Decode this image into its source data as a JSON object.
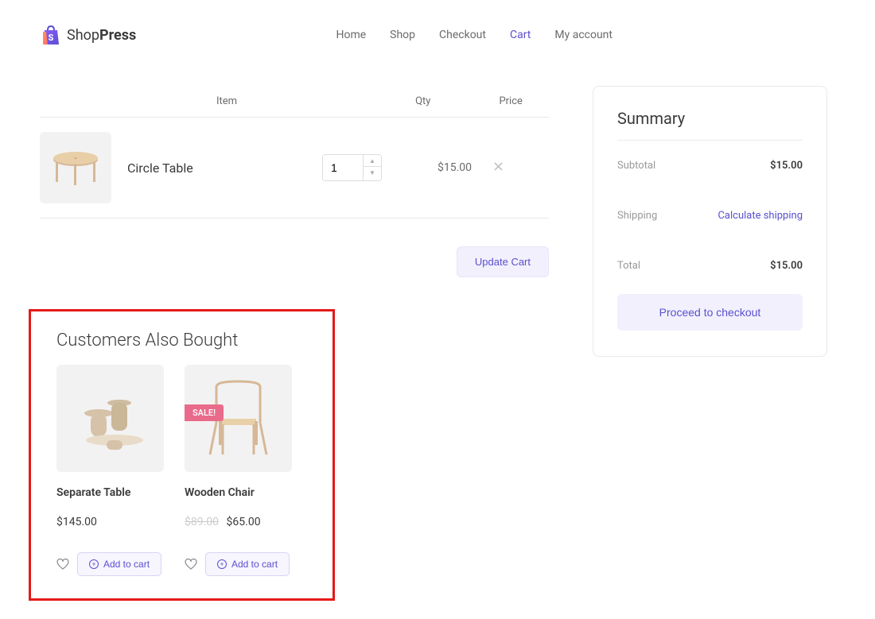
{
  "brand": {
    "name_part1": "Shop",
    "name_part2": "Press"
  },
  "nav": {
    "items": [
      {
        "label": "Home",
        "active": false
      },
      {
        "label": "Shop",
        "active": false
      },
      {
        "label": "Checkout",
        "active": false
      },
      {
        "label": "Cart",
        "active": true
      },
      {
        "label": "My account",
        "active": false
      }
    ]
  },
  "cart": {
    "columns": {
      "item": "Item",
      "qty": "Qty",
      "price": "Price"
    },
    "items": [
      {
        "name": "Circle Table",
        "qty": "1",
        "price": "$15.00"
      }
    ],
    "update_label": "Update Cart"
  },
  "crosssell": {
    "title": "Customers Also Bought",
    "items": [
      {
        "name": "Separate Table",
        "price": "$145.00",
        "add_label": "Add to cart"
      },
      {
        "name": "Wooden Chair",
        "old_price": "$89.00",
        "price": "$65.00",
        "sale": "SALE!",
        "add_label": "Add to cart"
      }
    ]
  },
  "summary": {
    "title": "Summary",
    "subtotal_label": "Subtotal",
    "subtotal_value": "$15.00",
    "shipping_label": "Shipping",
    "shipping_link": "Calculate shipping",
    "total_label": "Total",
    "total_value": "$15.00",
    "checkout_label": "Proceed to checkout"
  }
}
